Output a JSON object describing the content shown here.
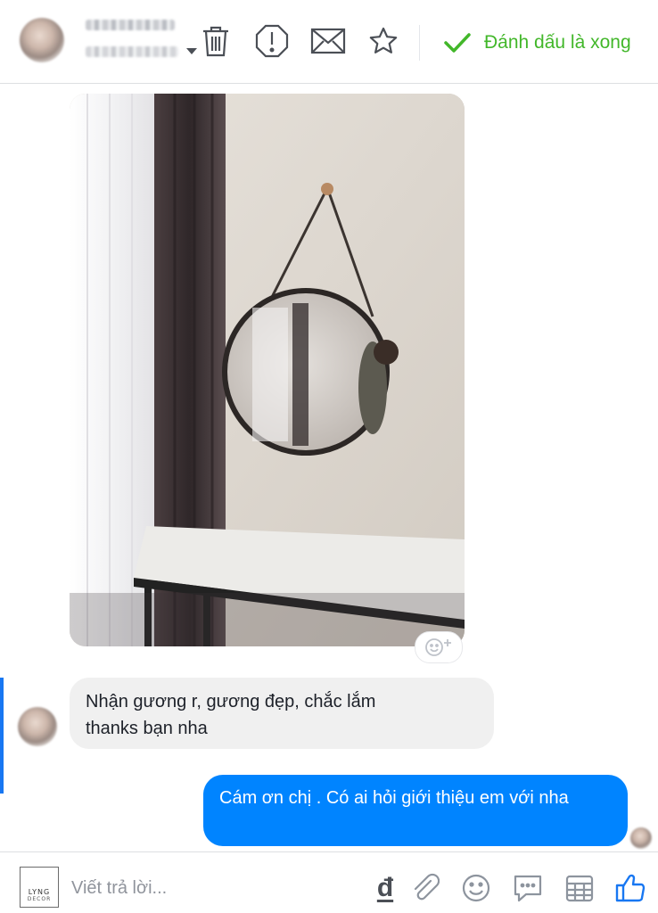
{
  "header": {
    "contact_name": "",
    "contact_status": "",
    "actions": [
      {
        "name": "trash-icon"
      },
      {
        "name": "alert-octagon-icon"
      },
      {
        "name": "envelope-icon"
      },
      {
        "name": "star-icon"
      }
    ],
    "mark_done_label": "Đánh dấu là xong",
    "accent_color": "#42b72a"
  },
  "conversation": {
    "photo": {
      "name": "round-mirror-photo"
    },
    "incoming": {
      "line1": "Nhận gương r, gương đẹp, chắc lắm",
      "line2": "thanks bạn nha",
      "bubble_color": "#f0f0f0"
    },
    "outgoing": {
      "text": "Cám ơn chị . Có ai hỏi giới thiệu em với nha",
      "bubble_color": "#0084ff"
    }
  },
  "composer": {
    "brand_line1": "LYNG",
    "brand_line2": "DECOR",
    "placeholder": "Viết trả lời...",
    "currency_symbol": "đ",
    "icons": [
      "currency-icon",
      "paperclip-icon",
      "emoji-icon",
      "chat-bubble-icon",
      "calendar-icon",
      "thumbs-up-icon"
    ],
    "like_color": "#1877f2"
  }
}
